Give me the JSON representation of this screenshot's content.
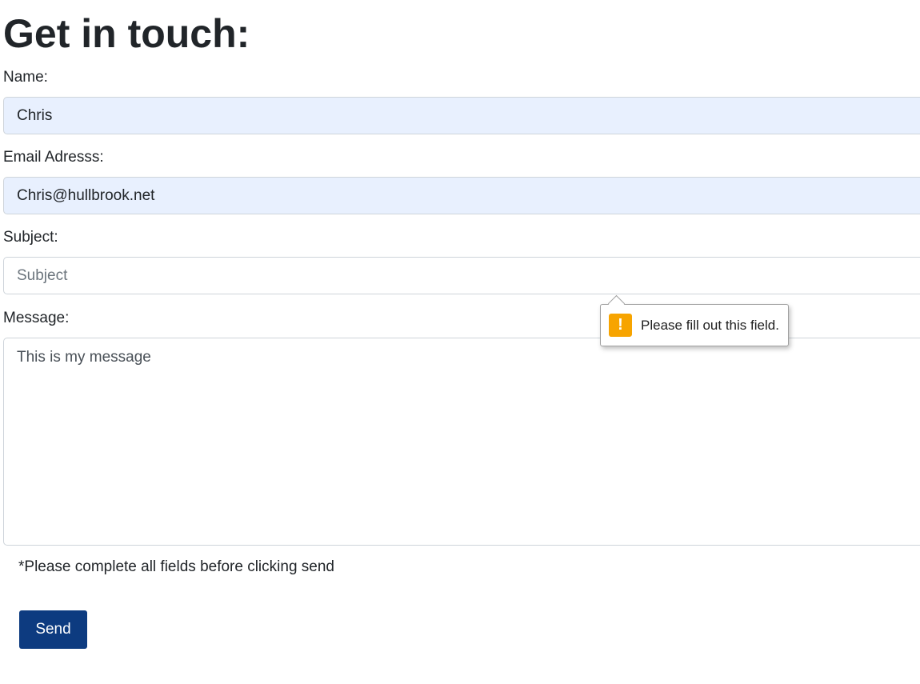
{
  "page": {
    "title": "Get in touch:"
  },
  "form": {
    "name": {
      "label": "Name:",
      "value": "Chris"
    },
    "email": {
      "label": "Email Adresss:",
      "value": "Chris@hullbrook.net"
    },
    "subject": {
      "label": "Subject:",
      "value": "",
      "placeholder": "Subject"
    },
    "message": {
      "label": "Message:",
      "value": "",
      "placeholder": "This is my message"
    },
    "note": "*Please complete all fields before clicking send",
    "send_label": "Send"
  },
  "validation_tooltip": {
    "icon": "warning-icon",
    "icon_glyph": "!",
    "text": "Please fill out this field.",
    "color": "#f7a400"
  },
  "colors": {
    "autofill_bg": "#e8f0fe",
    "button_bg": "#0d3b80"
  }
}
